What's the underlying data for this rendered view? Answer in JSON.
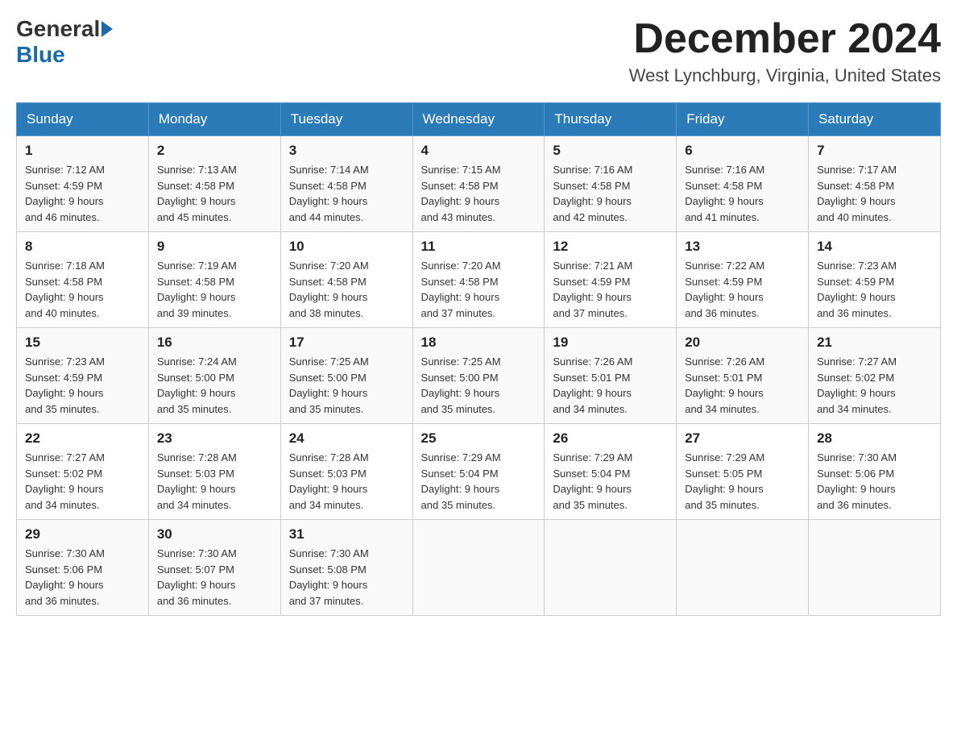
{
  "logo": {
    "general": "General",
    "blue": "Blue"
  },
  "title": {
    "month_year": "December 2024",
    "location": "West Lynchburg, Virginia, United States"
  },
  "weekdays": [
    "Sunday",
    "Monday",
    "Tuesday",
    "Wednesday",
    "Thursday",
    "Friday",
    "Saturday"
  ],
  "weeks": [
    [
      {
        "day": "1",
        "sunrise": "7:12 AM",
        "sunset": "4:59 PM",
        "daylight": "9 hours and 46 minutes."
      },
      {
        "day": "2",
        "sunrise": "7:13 AM",
        "sunset": "4:58 PM",
        "daylight": "9 hours and 45 minutes."
      },
      {
        "day": "3",
        "sunrise": "7:14 AM",
        "sunset": "4:58 PM",
        "daylight": "9 hours and 44 minutes."
      },
      {
        "day": "4",
        "sunrise": "7:15 AM",
        "sunset": "4:58 PM",
        "daylight": "9 hours and 43 minutes."
      },
      {
        "day": "5",
        "sunrise": "7:16 AM",
        "sunset": "4:58 PM",
        "daylight": "9 hours and 42 minutes."
      },
      {
        "day": "6",
        "sunrise": "7:16 AM",
        "sunset": "4:58 PM",
        "daylight": "9 hours and 41 minutes."
      },
      {
        "day": "7",
        "sunrise": "7:17 AM",
        "sunset": "4:58 PM",
        "daylight": "9 hours and 40 minutes."
      }
    ],
    [
      {
        "day": "8",
        "sunrise": "7:18 AM",
        "sunset": "4:58 PM",
        "daylight": "9 hours and 40 minutes."
      },
      {
        "day": "9",
        "sunrise": "7:19 AM",
        "sunset": "4:58 PM",
        "daylight": "9 hours and 39 minutes."
      },
      {
        "day": "10",
        "sunrise": "7:20 AM",
        "sunset": "4:58 PM",
        "daylight": "9 hours and 38 minutes."
      },
      {
        "day": "11",
        "sunrise": "7:20 AM",
        "sunset": "4:58 PM",
        "daylight": "9 hours and 37 minutes."
      },
      {
        "day": "12",
        "sunrise": "7:21 AM",
        "sunset": "4:59 PM",
        "daylight": "9 hours and 37 minutes."
      },
      {
        "day": "13",
        "sunrise": "7:22 AM",
        "sunset": "4:59 PM",
        "daylight": "9 hours and 36 minutes."
      },
      {
        "day": "14",
        "sunrise": "7:23 AM",
        "sunset": "4:59 PM",
        "daylight": "9 hours and 36 minutes."
      }
    ],
    [
      {
        "day": "15",
        "sunrise": "7:23 AM",
        "sunset": "4:59 PM",
        "daylight": "9 hours and 35 minutes."
      },
      {
        "day": "16",
        "sunrise": "7:24 AM",
        "sunset": "5:00 PM",
        "daylight": "9 hours and 35 minutes."
      },
      {
        "day": "17",
        "sunrise": "7:25 AM",
        "sunset": "5:00 PM",
        "daylight": "9 hours and 35 minutes."
      },
      {
        "day": "18",
        "sunrise": "7:25 AM",
        "sunset": "5:00 PM",
        "daylight": "9 hours and 35 minutes."
      },
      {
        "day": "19",
        "sunrise": "7:26 AM",
        "sunset": "5:01 PM",
        "daylight": "9 hours and 34 minutes."
      },
      {
        "day": "20",
        "sunrise": "7:26 AM",
        "sunset": "5:01 PM",
        "daylight": "9 hours and 34 minutes."
      },
      {
        "day": "21",
        "sunrise": "7:27 AM",
        "sunset": "5:02 PM",
        "daylight": "9 hours and 34 minutes."
      }
    ],
    [
      {
        "day": "22",
        "sunrise": "7:27 AM",
        "sunset": "5:02 PM",
        "daylight": "9 hours and 34 minutes."
      },
      {
        "day": "23",
        "sunrise": "7:28 AM",
        "sunset": "5:03 PM",
        "daylight": "9 hours and 34 minutes."
      },
      {
        "day": "24",
        "sunrise": "7:28 AM",
        "sunset": "5:03 PM",
        "daylight": "9 hours and 34 minutes."
      },
      {
        "day": "25",
        "sunrise": "7:29 AM",
        "sunset": "5:04 PM",
        "daylight": "9 hours and 35 minutes."
      },
      {
        "day": "26",
        "sunrise": "7:29 AM",
        "sunset": "5:04 PM",
        "daylight": "9 hours and 35 minutes."
      },
      {
        "day": "27",
        "sunrise": "7:29 AM",
        "sunset": "5:05 PM",
        "daylight": "9 hours and 35 minutes."
      },
      {
        "day": "28",
        "sunrise": "7:30 AM",
        "sunset": "5:06 PM",
        "daylight": "9 hours and 36 minutes."
      }
    ],
    [
      {
        "day": "29",
        "sunrise": "7:30 AM",
        "sunset": "5:06 PM",
        "daylight": "9 hours and 36 minutes."
      },
      {
        "day": "30",
        "sunrise": "7:30 AM",
        "sunset": "5:07 PM",
        "daylight": "9 hours and 36 minutes."
      },
      {
        "day": "31",
        "sunrise": "7:30 AM",
        "sunset": "5:08 PM",
        "daylight": "9 hours and 37 minutes."
      },
      null,
      null,
      null,
      null
    ]
  ],
  "labels": {
    "sunrise": "Sunrise:",
    "sunset": "Sunset:",
    "daylight": "Daylight:"
  }
}
